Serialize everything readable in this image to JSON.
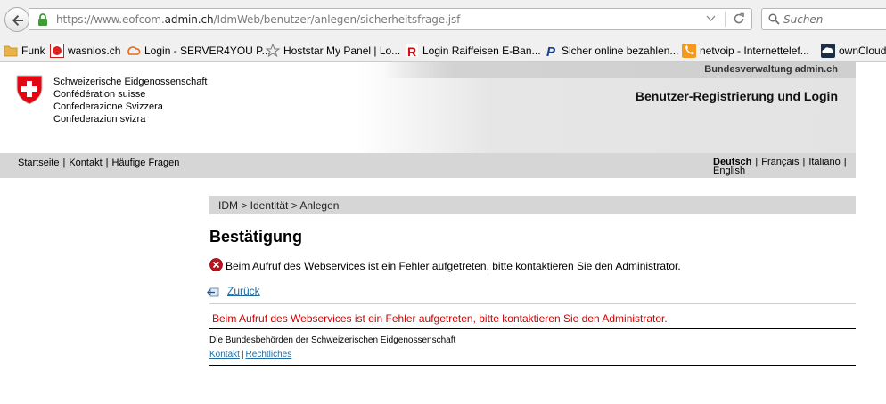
{
  "browser": {
    "url_prefix": "https://www.eofcom.",
    "url_domain": "admin.ch",
    "url_path": "/IdmWeb/benutzer/anlegen/sicherheitsfrage.jsf",
    "search_placeholder": "Suchen",
    "bookmarks": [
      {
        "label": "Funk",
        "icon": "folder-icon"
      },
      {
        "label": "wasnlos.ch",
        "icon": "wasnlos-icon"
      },
      {
        "label": "Login - SERVER4YOU P...",
        "icon": "server4you-icon"
      },
      {
        "label": "Hoststar My Panel | Lo...",
        "icon": "hoststar-star-icon"
      },
      {
        "label": "Login Raiffeisen E-Ban...",
        "icon": "raiffeisen-icon"
      },
      {
        "label": "Sicher online bezahlen...",
        "icon": "paypal-icon"
      },
      {
        "label": "netvoip - Internettelef...",
        "icon": "netvoip-phone-icon"
      },
      {
        "label": "ownCloud",
        "icon": "owncloud-icon"
      }
    ]
  },
  "header": {
    "topbar": "Bundesverwaltung admin.ch",
    "confederation": [
      "Schweizerische Eidgenossenschaft",
      "Confédération suisse",
      "Confederazione Svizzera",
      "Confederaziun svizra"
    ],
    "title": "Benutzer-Registrierung und Login"
  },
  "nav": {
    "items": [
      "Startseite",
      "Kontakt",
      "Häufige Fragen"
    ],
    "languages": [
      "Deutsch",
      "Français",
      "Italiano",
      "English"
    ],
    "active_language": "Deutsch"
  },
  "content": {
    "breadcrumb": "IDM > Identität > Anlegen",
    "title": "Bestätigung",
    "error_message": "Beim Aufruf des Webservices ist ein Fehler aufgetreten, bitte kontaktieren Sie den Administrator.",
    "back_label": "Zurück",
    "red_error_message": "Beim Aufruf des Webservices ist ein Fehler aufgetreten, bitte kontaktieren Sie den Administrator."
  },
  "footer": {
    "text": "Die Bundesbehörden der Schweizerischen Eidgenossenschaft",
    "links": [
      "Kontakt",
      "Rechtliches"
    ]
  },
  "colors": {
    "link": "#206ba1",
    "error_red": "#d00000",
    "swiss_red": "#e30613",
    "nav_gray": "#d6d6d6"
  }
}
